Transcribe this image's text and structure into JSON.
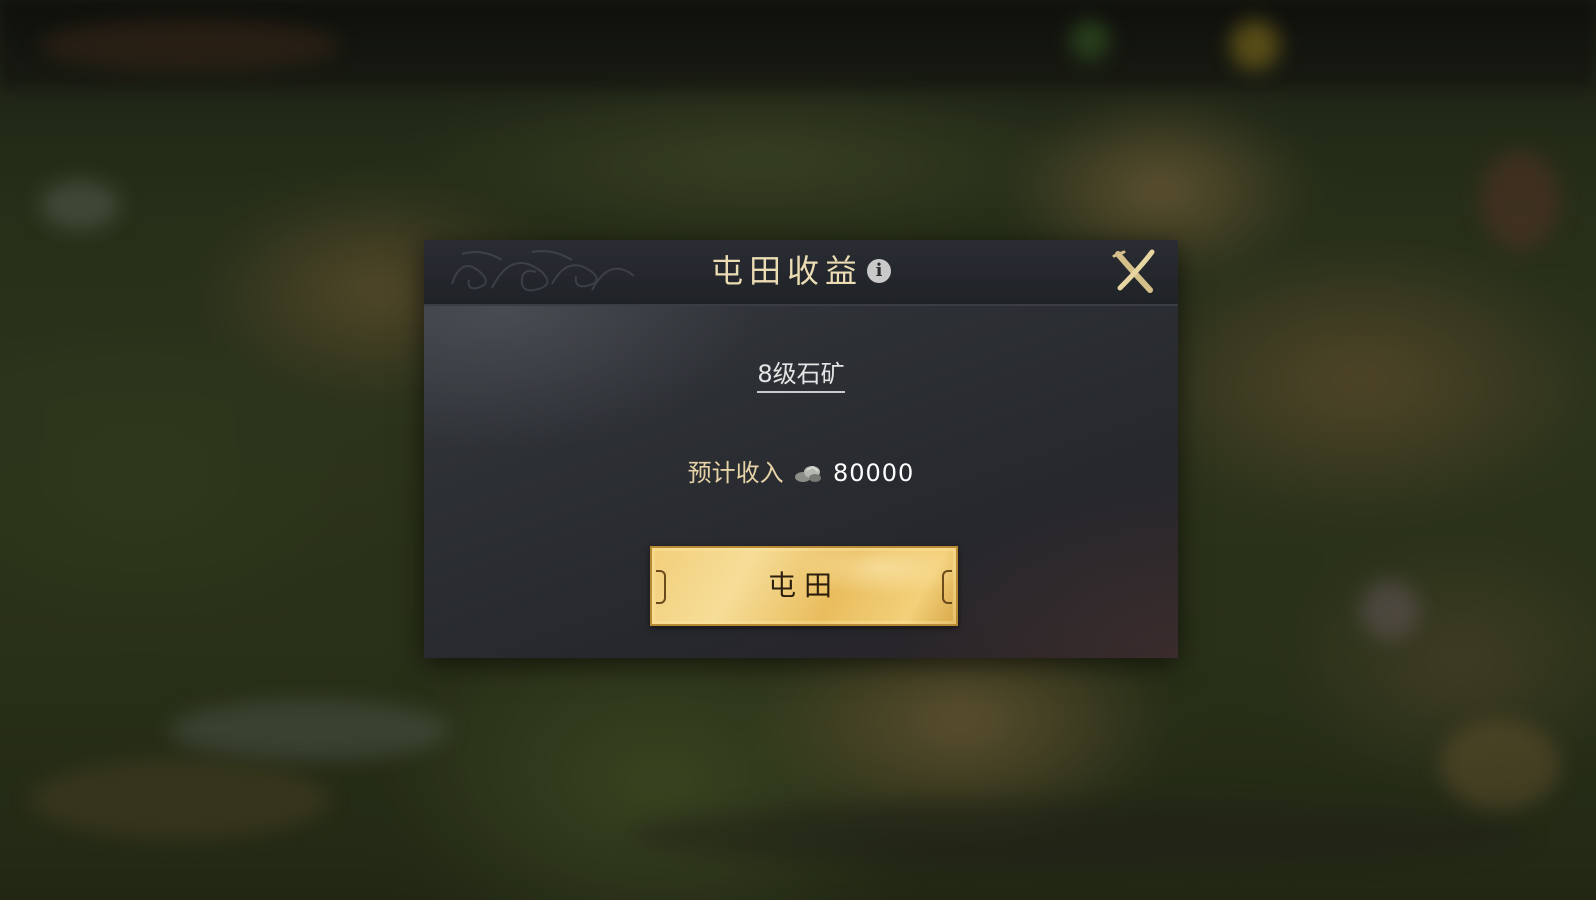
{
  "dialog": {
    "title": "屯田收益",
    "info_icon": "info-icon",
    "close_icon": "close-x-icon",
    "mine_name": "8级石矿",
    "income_label": "预计收入",
    "resource_icon": "stone-icon",
    "income_value": "80000",
    "action_label": "屯田"
  },
  "colors": {
    "title": "#ecdcb4",
    "income_label": "#e6d3a6",
    "button_gold": "#f2cf7a",
    "panel": "#2d3035"
  }
}
